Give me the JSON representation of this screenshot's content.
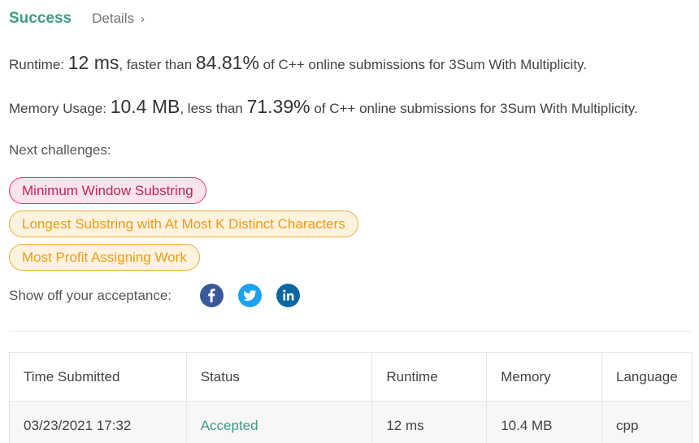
{
  "header": {
    "status": "Success",
    "details_label": "Details",
    "details_chevron": "›"
  },
  "runtime": {
    "label": "Runtime: ",
    "value": "12 ms",
    "middle": ", faster than ",
    "percent": "84.81%",
    "suffix": " of C++ online submissions for 3Sum With Multiplicity."
  },
  "memory": {
    "label": "Memory Usage: ",
    "value": "10.4 MB",
    "middle": ", less than ",
    "percent": "71.39%",
    "suffix": " of C++ online submissions for 3Sum With Multiplicity."
  },
  "next_challenges": {
    "label": "Next challenges:",
    "items": [
      {
        "label": "Minimum Window Substring",
        "difficulty": "hard",
        "color": "#e0336e"
      },
      {
        "label": "Longest Substring with At Most K Distinct Characters",
        "difficulty": "medium",
        "color": "#f0a93a"
      },
      {
        "label": "Most Profit Assigning Work",
        "difficulty": "medium",
        "color": "#f0a93a"
      }
    ]
  },
  "share": {
    "label": "Show off your acceptance:",
    "icons": [
      "facebook-icon",
      "twitter-icon",
      "linkedin-icon"
    ]
  },
  "submissions": {
    "headers": [
      "Time Submitted",
      "Status",
      "Runtime",
      "Memory",
      "Language"
    ],
    "rows": [
      [
        "03/23/2021 17:32",
        "Accepted",
        "12 ms",
        "10.4 MB",
        "cpp"
      ]
    ]
  },
  "colors": {
    "success": "#3e9b86",
    "facebook": "#3b5998",
    "twitter": "#1da1f2",
    "linkedin": "#0a66a0"
  }
}
